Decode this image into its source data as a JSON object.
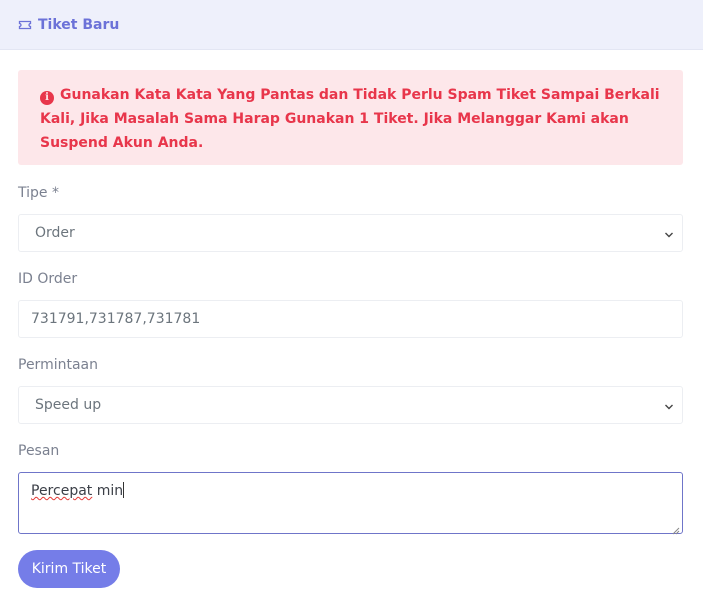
{
  "header": {
    "title": "Tiket Baru",
    "icon": "ticket-icon"
  },
  "alert": {
    "icon": "info-circle-icon",
    "message": "Gunakan Kata Kata Yang Pantas dan Tidak Perlu Spam Tiket Sampai Berkali Kali, Jika Masalah Sama Harap Gunakan 1 Tiket. Jika Melanggar Kami akan Suspend Akun Anda."
  },
  "form": {
    "tipe": {
      "label": "Tipe *",
      "value": "Order"
    },
    "id_order": {
      "label": "ID Order",
      "value": "731791,731787,731781"
    },
    "permintaan": {
      "label": "Permintaan",
      "value": "Speed up"
    },
    "pesan": {
      "label": "Pesan",
      "value_misspelled": "Percepat",
      "value_rest": " min"
    },
    "submit_label": "Kirim Tiket"
  },
  "colors": {
    "accent": "#757de8",
    "header_bg": "#eef0fb",
    "alert_bg": "#fde7ea",
    "alert_text": "#e8364b"
  }
}
